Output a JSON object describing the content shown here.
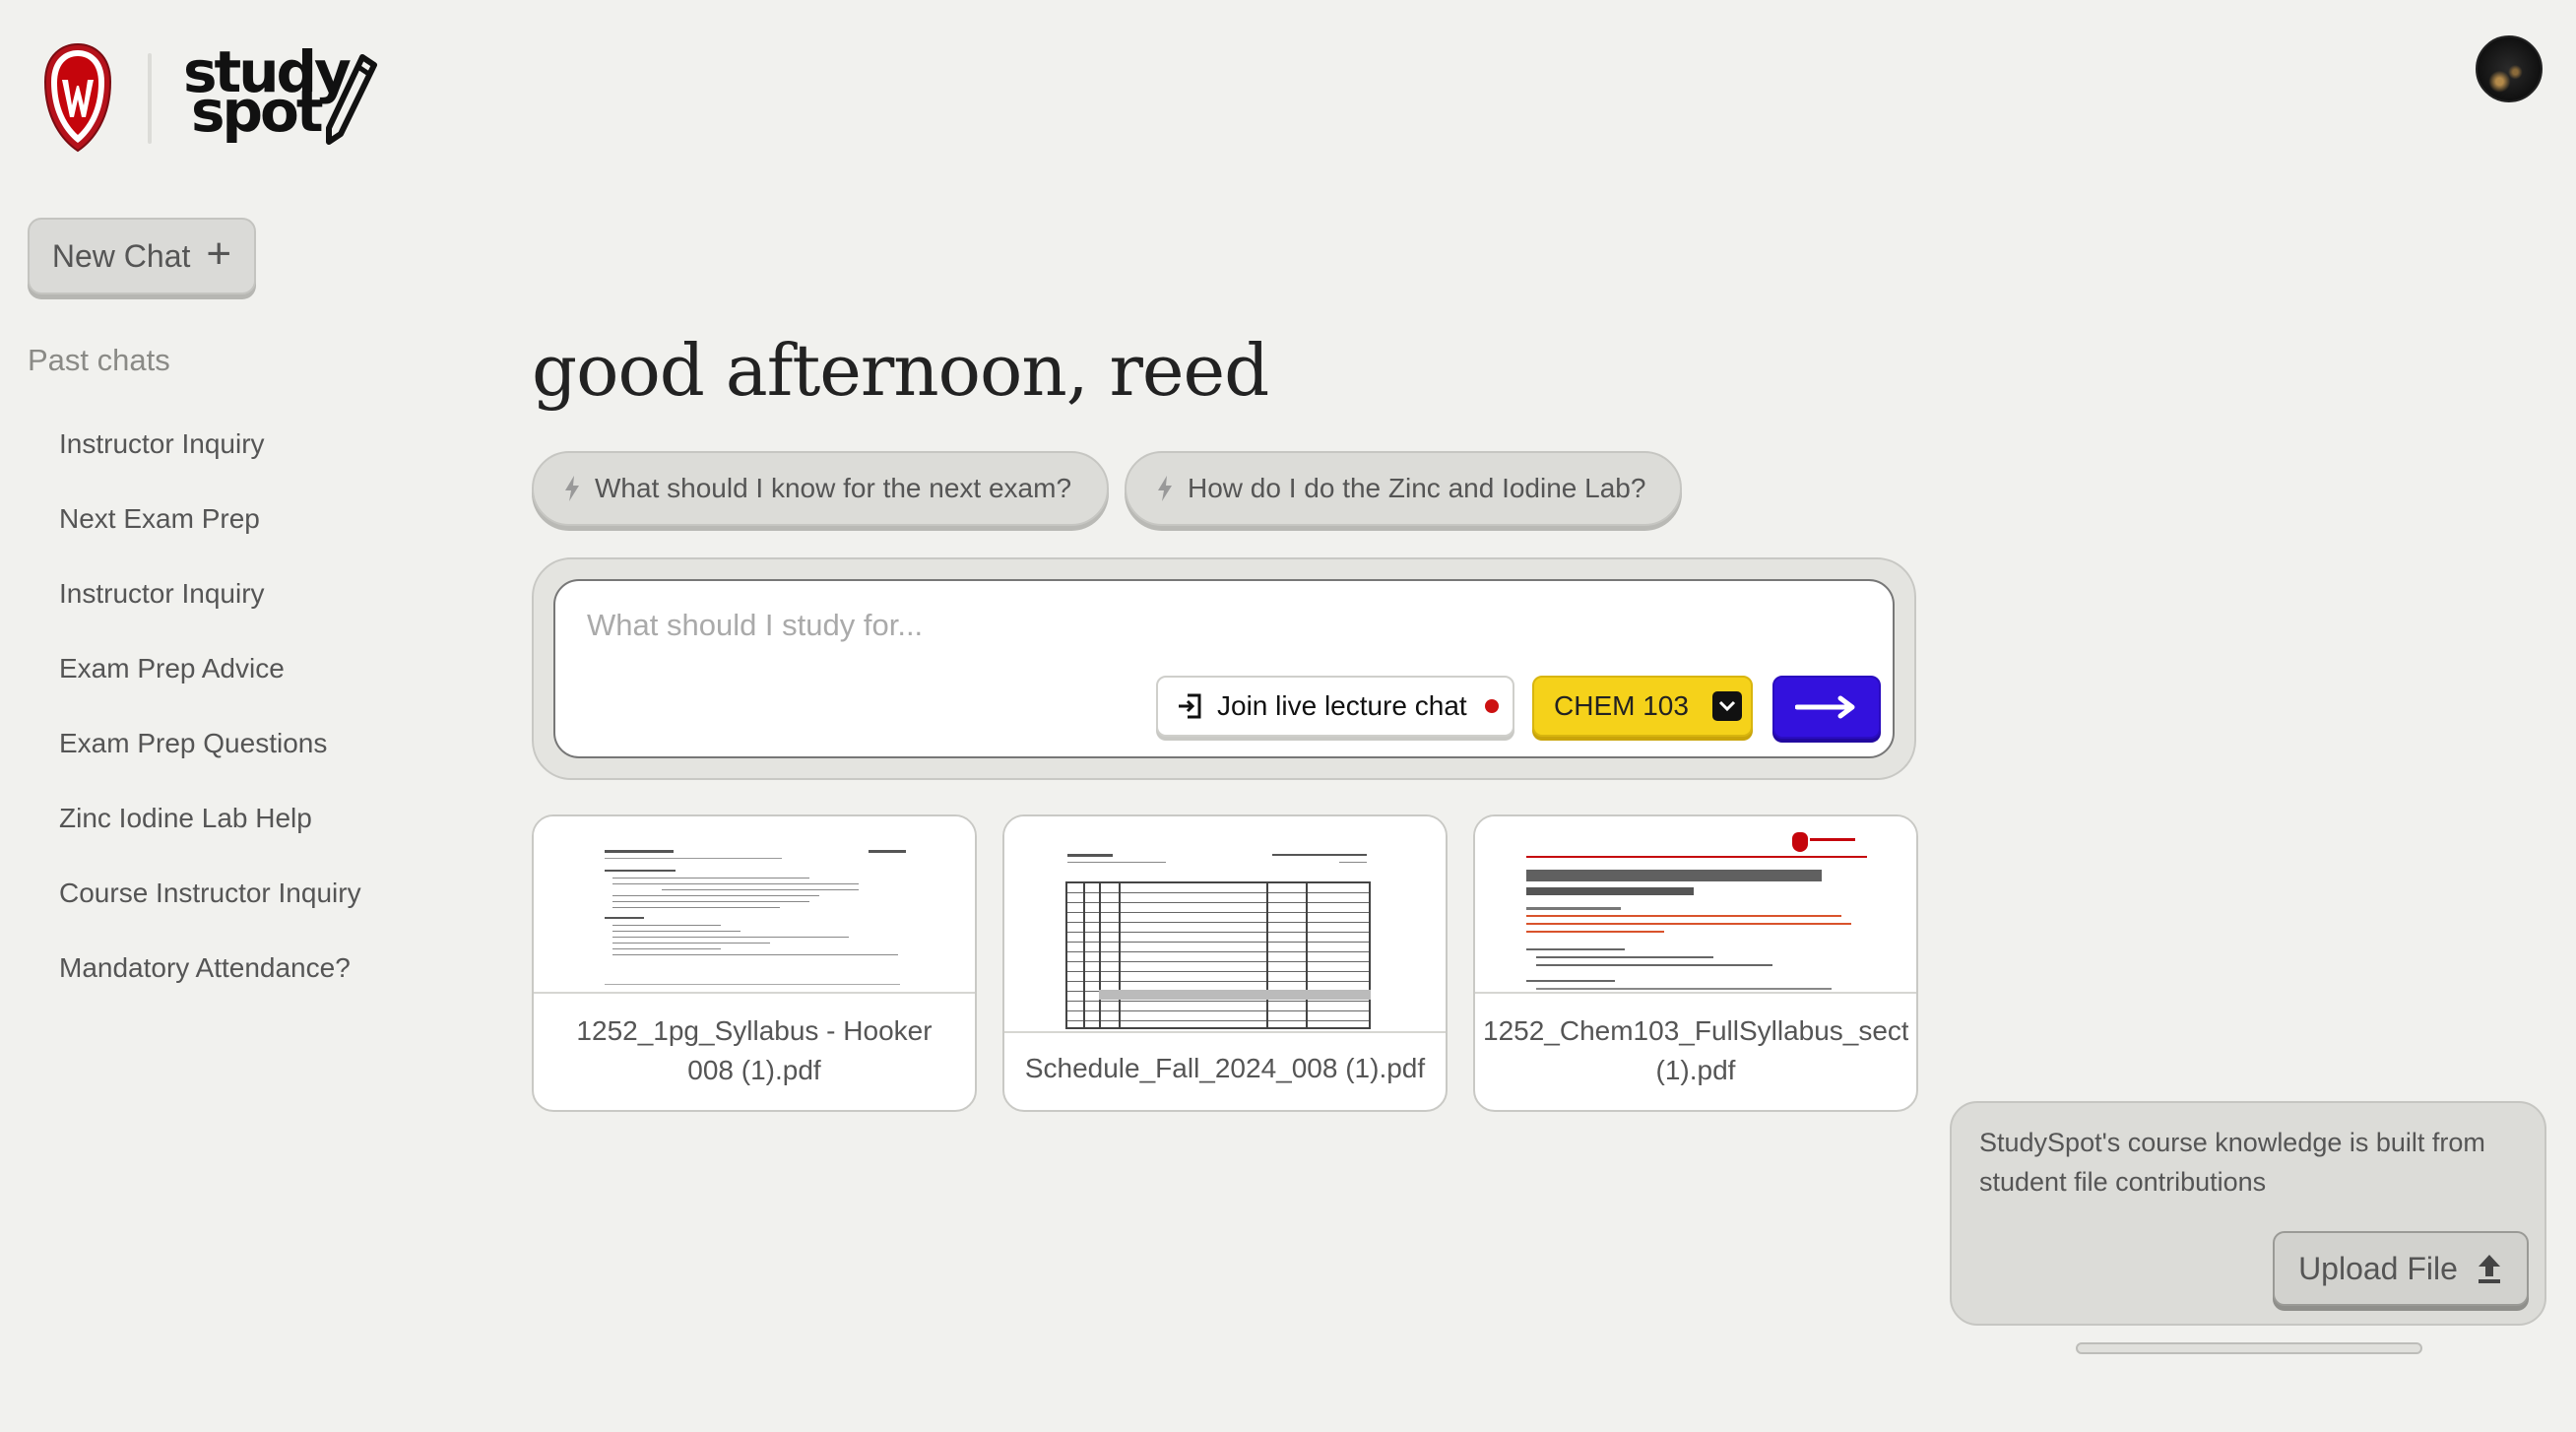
{
  "brand": {
    "wordmark_top": "study",
    "wordmark_bottom": "spot"
  },
  "sidebar": {
    "new_chat_label": "New Chat",
    "past_chats_title": "Past chats",
    "past_chats": [
      "Instructor Inquiry",
      "Next Exam Prep",
      "Instructor Inquiry",
      "Exam Prep Advice",
      "Exam Prep Questions",
      "Zinc Iodine Lab Help",
      "Course Instructor Inquiry",
      "Mandatory Attendance?"
    ]
  },
  "main": {
    "greeting": "good afternoon, reed",
    "suggestions": [
      "What should I know for the next exam?",
      "How do I do the Zinc and Iodine Lab?"
    ],
    "composer": {
      "placeholder": "What should I study for...",
      "join_label": "Join live lecture chat",
      "course": "CHEM 103"
    },
    "files": [
      {
        "name": "1252_1pg_Syllabus - Hooker\n008 (1).pdf"
      },
      {
        "name": "Schedule_Fall_2024_008 (1).pdf"
      },
      {
        "name": "1252_Chem103_FullSyllabus_sect\n(1).pdf"
      }
    ]
  },
  "contribute": {
    "text": "StudySpot's course knowledge is built from student file contributions",
    "upload_label": "Upload File"
  },
  "icons": {
    "crest": "uw-crest-icon",
    "pencil": "pencil-icon",
    "plus": "plus-icon",
    "bolt": "bolt-icon",
    "join": "enter-icon",
    "chevron": "chevron-down-icon",
    "send": "arrow-right-icon",
    "upload": "upload-icon"
  },
  "colors": {
    "background": "#f1f1ee",
    "course_chip": "#f5d21a",
    "send": "#3311dd",
    "crest_red": "#c5050c",
    "live_dot": "#cc1111"
  }
}
